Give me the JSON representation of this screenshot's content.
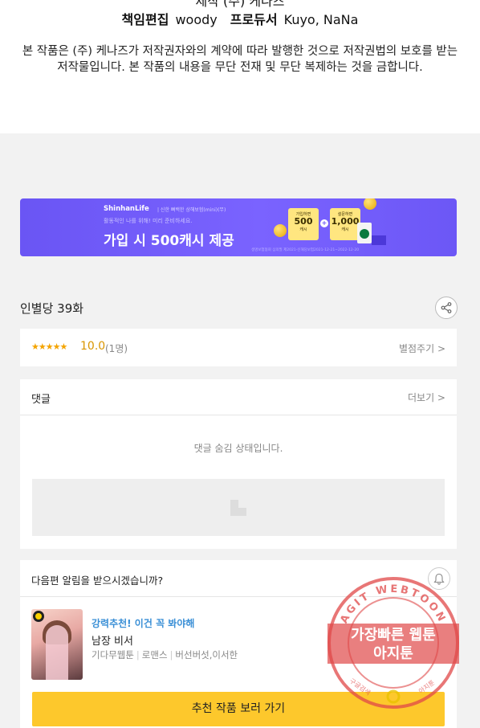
{
  "credits": {
    "cut_line": "제작 (주) 케나즈",
    "editor_label": "책임편집",
    "editor_value": "woody",
    "producer_label": "프로듀서",
    "producer_value": "Kuyo, NaNa"
  },
  "copyright": "본 작품은 (주) 케나즈가 저작권자와의 계약에 따라 발행한 것으로 저작권법의 보호를 받는 저작물입니다. 본 작품의 내용을 무단 전재 및 무단 복제하는 것을 금합니다.",
  "banner": {
    "brand": "ShinhanLife",
    "brand_sub": "| 신한 뼈백한 상해보험(mini)(무)",
    "desc": "활동적인 나를 위해! 미리 준비하세요.",
    "headline": "가입 시 500캐시 제공",
    "card1_top": "가입하면",
    "card1_value": "500",
    "card1_unit": "캐시",
    "card2_top": "설문하면",
    "card2_value": "1,000",
    "card2_unit": "캐시",
    "fine_print": "생명보험협회 심의필 제2021-신해당보험2021-12-21~2022-12-20"
  },
  "episode": {
    "title": "인별당 39화"
  },
  "rating": {
    "stars": "★★★★★",
    "score": "10.0",
    "count": "(1명)",
    "rate_link": "별점주기 >"
  },
  "comments": {
    "title": "댓글",
    "more": "더보기 >",
    "hidden_notice": "댓글 숨김 상태입니다."
  },
  "next_episode": {
    "question": "다음편 알림을 받으시겠습니까?",
    "rec_tag": "강력추천! 이건 꼭 봐야해",
    "rec_title": "남장 비서",
    "rec_meta": [
      "기다무웹툰",
      "로맨스",
      "버선버섯,이서한"
    ],
    "cta": "추천 작품 보러 가기"
  },
  "watermark": {
    "ring_text": "AGIT WEBTOON",
    "line1": "가장빠른 웹툰",
    "line2": "아지툰",
    "bottom_left": "구글검색",
    "bottom_right": "아지툰"
  },
  "colors": {
    "accent_yellow": "#fdc82c",
    "banner_purple": "#6a55f4",
    "star_orange": "#f4a400",
    "rec_blue": "#3a8fd6",
    "stamp_red": "#e04848"
  }
}
